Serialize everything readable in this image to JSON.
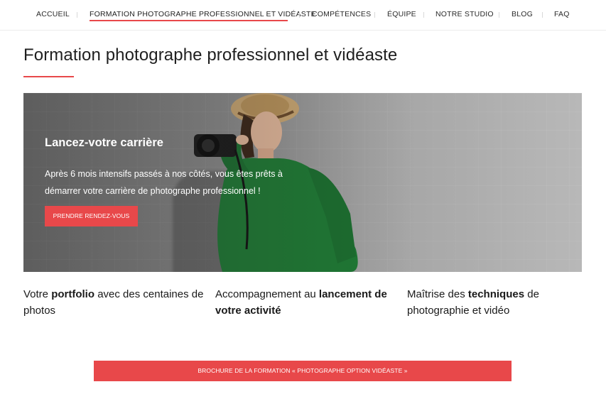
{
  "nav": {
    "items": [
      {
        "label": "Accueil"
      },
      {
        "label": "Formation photographe professionnel et vidéaste",
        "active": true
      },
      {
        "label": "Compétences"
      },
      {
        "label": "Équipe"
      },
      {
        "label": "Notre studio"
      },
      {
        "label": "Blog"
      },
      {
        "label": "FAQ"
      }
    ]
  },
  "page": {
    "title": "Formation photographe professionnel et vidéaste"
  },
  "hero": {
    "heading": "Lancez-votre carrière",
    "text": "Après 6 mois intensifs passés à nos côtés, vous êtes prêts à démarrer votre carrière de photographe professionnel !",
    "button_label": "Prendre rendez-vous"
  },
  "features": [
    {
      "before": "Votre ",
      "bold": "portfolio",
      "after": " avec des centaines de photos"
    },
    {
      "before": "Accompagnement au ",
      "bold": "lancement de votre activité",
      "after": ""
    },
    {
      "before": "Maîtrise des ",
      "bold": "techniques",
      "after": " de photographie et vidéo"
    }
  ],
  "brochure": {
    "label": "Brochure de la formation « Photographe option vidéaste »"
  },
  "colors": {
    "accent": "#e8484a",
    "sweater": "#1e7a34",
    "hat": "#c9a672"
  }
}
